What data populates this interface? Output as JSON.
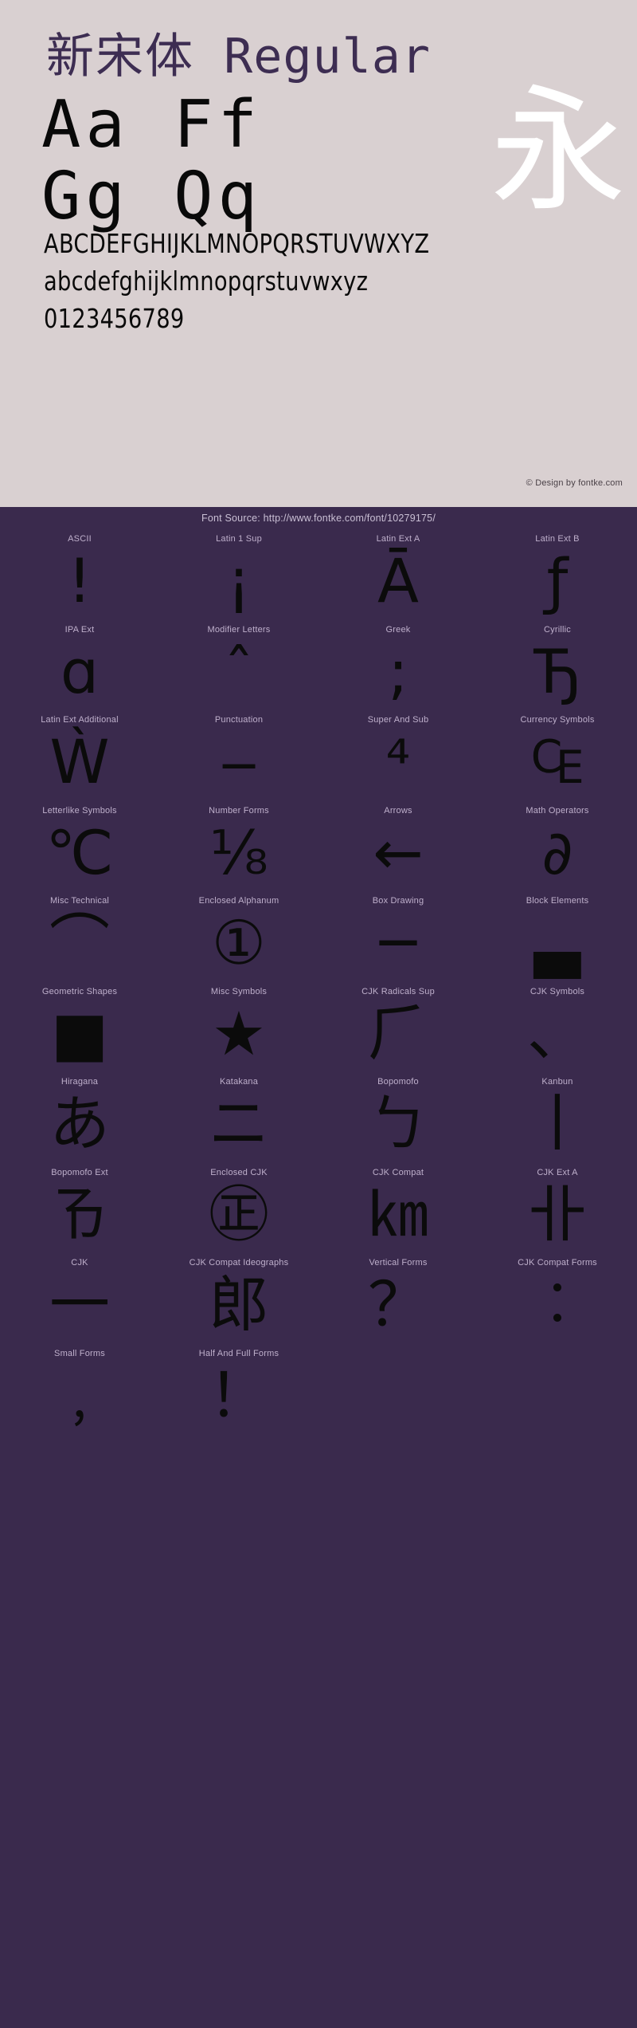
{
  "header": {
    "title_cjk": "新宋体",
    "title_latin": " Regular",
    "sample_pairs_line1": "Aa  Ff",
    "sample_pairs_line2": "Gg  Qq",
    "showcase_glyph": "永",
    "uppercase": "ABCDEFGHIJKLMNOPQRSTUVWXYZ",
    "lowercase": "abcdefghijklmnopqrstuvwxyz",
    "digits": "0123456789",
    "copyright": "© Design by fontke.com",
    "font_source": "Font Source: http://www.fontke.com/font/10279175/"
  },
  "colors": {
    "panel_background": "#d9d0d1",
    "dark_background": "#3a2a4d",
    "title_color": "#3d2d52",
    "glyph_color": "#0b0b0b",
    "showcase_glyph_color": "#ffffff",
    "block_label_color": "#bfb0cc",
    "source_text_color": "#c9bfd4"
  },
  "unicode_blocks": [
    {
      "label": "ASCII",
      "glyph": "!"
    },
    {
      "label": "Latin 1 Sup",
      "glyph": "¡"
    },
    {
      "label": "Latin Ext A",
      "glyph": "Ā"
    },
    {
      "label": "Latin Ext B",
      "glyph": "ƒ"
    },
    {
      "label": "IPA Ext",
      "glyph": "ɑ"
    },
    {
      "label": "Modifier Letters",
      "glyph": "ˆ"
    },
    {
      "label": "Greek",
      "glyph": ";"
    },
    {
      "label": "Cyrillic",
      "glyph": "Ђ"
    },
    {
      "label": "Latin Ext Additional",
      "glyph": "Ẁ"
    },
    {
      "label": "Punctuation",
      "glyph": "‒"
    },
    {
      "label": "Super And Sub",
      "glyph": "⁴"
    },
    {
      "label": "Currency Symbols",
      "glyph": "₠"
    },
    {
      "label": "Letterlike Symbols",
      "glyph": "℃"
    },
    {
      "label": "Number Forms",
      "glyph": "⅛"
    },
    {
      "label": "Arrows",
      "glyph": "←"
    },
    {
      "label": "Math Operators",
      "glyph": "∂"
    },
    {
      "label": "Misc Technical",
      "glyph": "⌒"
    },
    {
      "label": "Enclosed Alphanum",
      "glyph": "①"
    },
    {
      "label": "Box Drawing",
      "glyph": "─"
    },
    {
      "label": "Block Elements",
      "glyph": "▃"
    },
    {
      "label": "Geometric Shapes",
      "glyph": "■"
    },
    {
      "label": "Misc Symbols",
      "glyph": "★"
    },
    {
      "label": "CJK Radicals Sup",
      "glyph": "⺁"
    },
    {
      "label": "CJK Symbols",
      "glyph": "、"
    },
    {
      "label": "Hiragana",
      "glyph": "あ"
    },
    {
      "label": "Katakana",
      "glyph": "ニ"
    },
    {
      "label": "Bopomofo",
      "glyph": "ㄅ"
    },
    {
      "label": "Kanbun",
      "glyph": "丨"
    },
    {
      "label": "Bopomofo Ext",
      "glyph": "ㄯ"
    },
    {
      "label": "Enclosed CJK",
      "glyph": "㊣"
    },
    {
      "label": "CJK Compat",
      "glyph": "㎞"
    },
    {
      "label": "CJK Ext A",
      "glyph": "卝"
    },
    {
      "label": "CJK",
      "glyph": "一"
    },
    {
      "label": "CJK Compat Ideographs",
      "glyph": "郎"
    },
    {
      "label": "Vertical Forms",
      "glyph": "？"
    },
    {
      "label": "CJK Compat Forms",
      "glyph": "︰"
    },
    {
      "label": "Small Forms",
      "glyph": "﹐"
    },
    {
      "label": "Half And Full Forms",
      "glyph": "！"
    },
    {
      "label": "",
      "glyph": ""
    },
    {
      "label": "",
      "glyph": ""
    }
  ]
}
